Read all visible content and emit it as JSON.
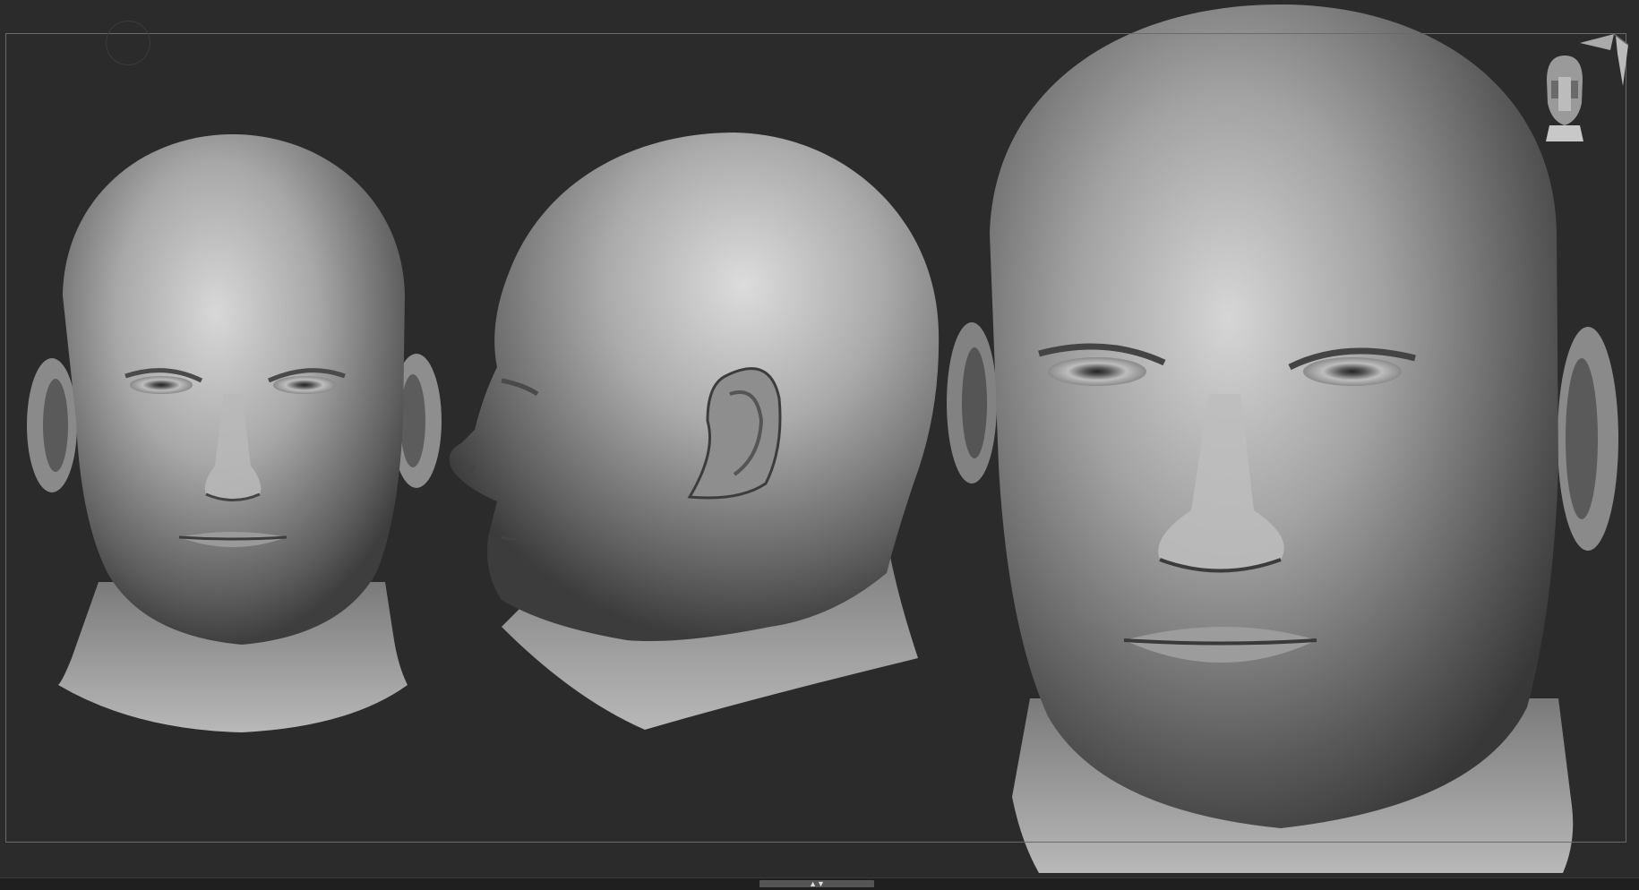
{
  "app": {
    "name": "",
    "canvas_background": "#2b2b2b",
    "frame_color": "#6a6a6a"
  },
  "viewport": {
    "models": [
      {
        "name": "front-view-head"
      },
      {
        "name": "profile-view-head"
      },
      {
        "name": "closeup-view-head"
      }
    ],
    "nav_cube_icon": "head-nav-cube-icon",
    "corner_controls_icon": "perspective-arrows-icon"
  },
  "tray": {
    "handle_icon": "tray-toggle-arrows-icon",
    "handle_glyph": "▲▼"
  }
}
